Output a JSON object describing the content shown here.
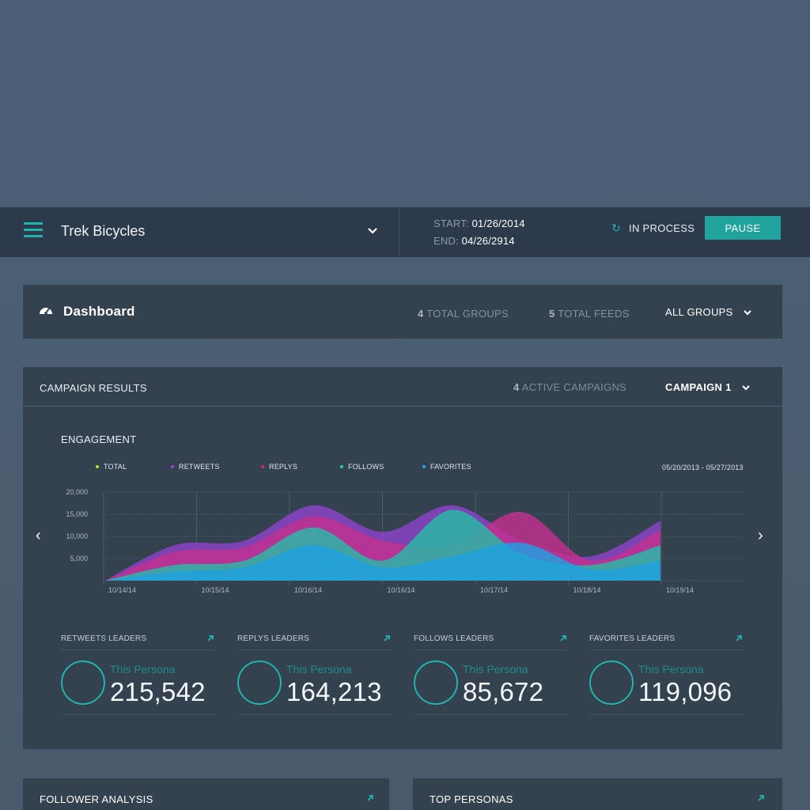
{
  "header": {
    "brand": "Trek Bicycles",
    "start_label": "START:",
    "start_date": "01/26/2014",
    "end_label": "END:",
    "end_date": "04/26/2914",
    "status": "IN PROCESS",
    "pause_label": "PAUSE"
  },
  "dashboard": {
    "title": "Dashboard",
    "groups_count": "4",
    "groups_label": "TOTAL GROUPS",
    "feeds_count": "5",
    "feeds_label": "TOTAL FEEDS",
    "group_filter": "ALL GROUPS"
  },
  "campaign": {
    "title": "CAMPAIGN RESULTS",
    "active_count": "4",
    "active_label": "ACTIVE CAMPAIGNS",
    "selected": "CAMPAIGN 1"
  },
  "engagement": {
    "title": "ENGAGEMENT",
    "date_range": "05/20/2013 - 05/27/2013"
  },
  "chart_data": {
    "type": "area",
    "x": [
      "10/14/14",
      "10/15/14",
      "10/16/14",
      "10/16/14",
      "10/17/14",
      "10/18/14",
      "10/19/14"
    ],
    "ylim": [
      0,
      20000
    ],
    "yticks": [
      "20,000",
      "15,000",
      "10,000",
      "5,000"
    ],
    "legend": [
      {
        "name": "TOTAL",
        "color": "#b7e031"
      },
      {
        "name": "RETWEETS",
        "color": "#a13ed6"
      },
      {
        "name": "REPLYS",
        "color": "#d9207e"
      },
      {
        "name": "FOLLOWS",
        "color": "#23cfae"
      },
      {
        "name": "FAVORITES",
        "color": "#21a9ea"
      }
    ],
    "series": [
      {
        "name": "RETWEETS",
        "color": "#8a3fc8",
        "values": [
          0,
          8000,
          9000,
          17000,
          11000,
          17000,
          9000,
          5500,
          13500
        ]
      },
      {
        "name": "REPLYS",
        "color": "#c12c8e",
        "values": [
          0,
          6500,
          7500,
          14500,
          9000,
          8000,
          15500,
          4500,
          11500
        ]
      },
      {
        "name": "FOLLOWS",
        "color": "#22b9a4",
        "values": [
          0,
          3500,
          4500,
          12000,
          4500,
          16000,
          6000,
          3500,
          8000
        ]
      },
      {
        "name": "FAVORITES",
        "color": "#1a9fe0",
        "values": [
          0,
          2000,
          3000,
          8000,
          3000,
          5500,
          8500,
          2500,
          4500
        ]
      }
    ]
  },
  "leaders": [
    {
      "title": "RETWEETS LEADERS",
      "persona": "This Persona",
      "value": "215,542"
    },
    {
      "title": "REPLYS LEADERS",
      "persona": "This Persona",
      "value": "164,213"
    },
    {
      "title": "FOLLOWS LEADERS",
      "persona": "This Persona",
      "value": "85,672"
    },
    {
      "title": "FAVORITES LEADERS",
      "persona": "This Persona",
      "value": "119,096"
    }
  ],
  "bottom": {
    "follower": "FOLLOWER ANALYSIS",
    "personas": "TOP PERSONAS"
  },
  "colors": {
    "accent": "#1fb5ac",
    "panel": "#34414f",
    "header": "#2d3a4b"
  }
}
